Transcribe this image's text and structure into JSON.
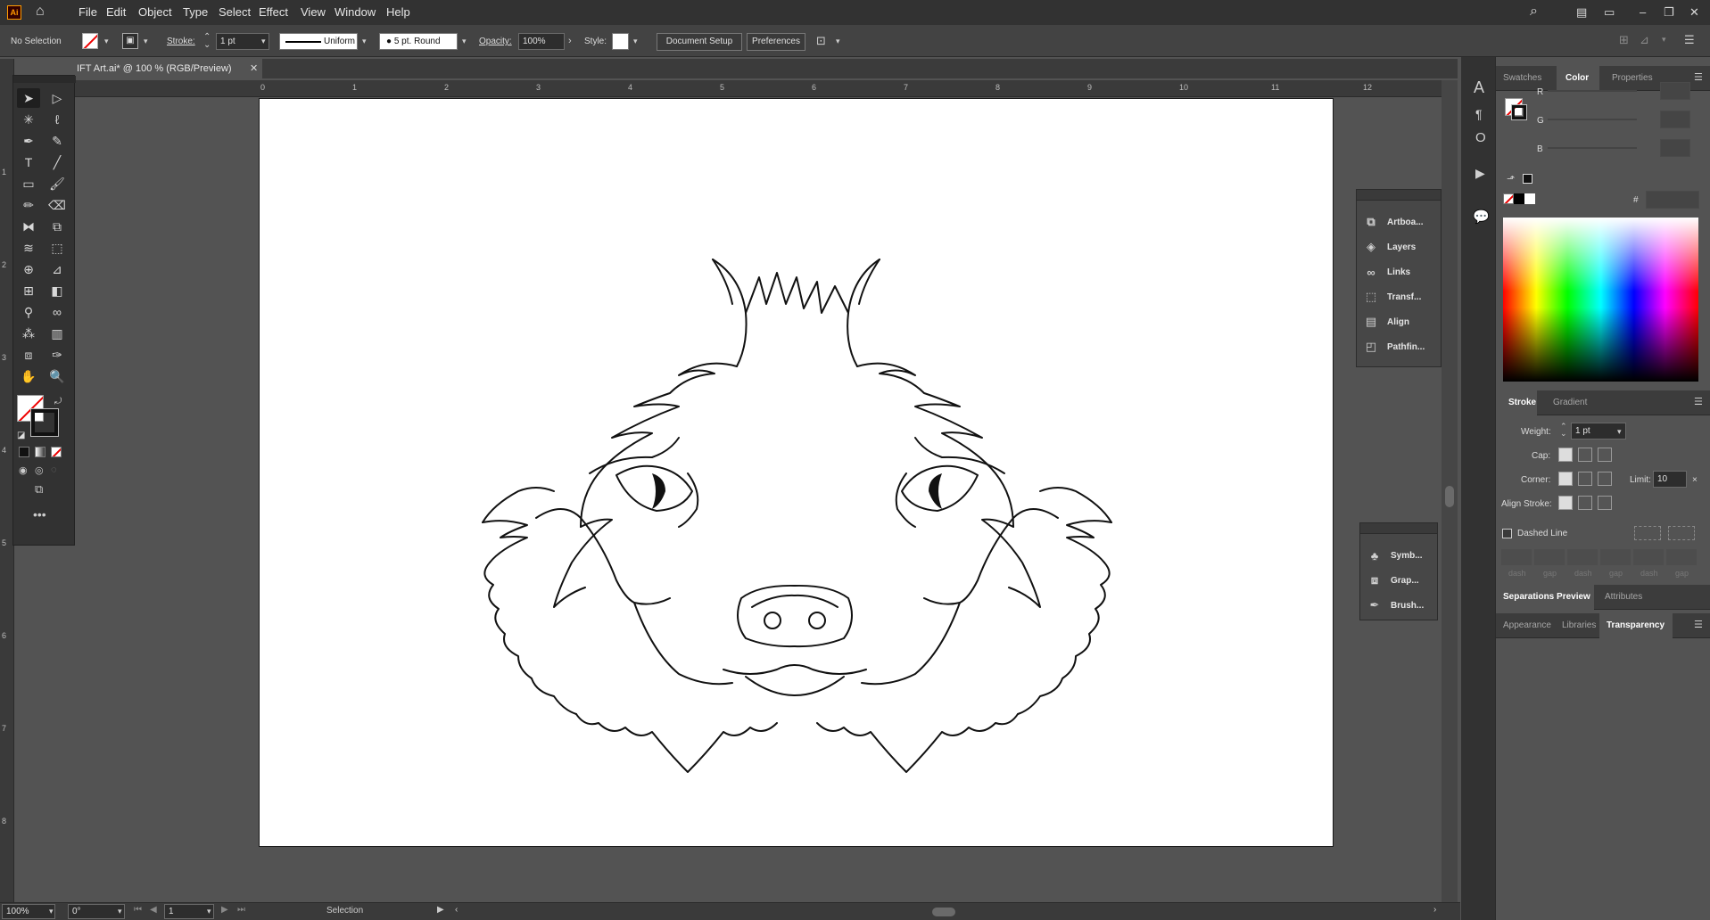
{
  "app": {
    "logo_text": "Ai"
  },
  "menu": [
    "File",
    "Edit",
    "Object",
    "Type",
    "Select",
    "Effect",
    "View",
    "Window",
    "Help"
  ],
  "control_bar": {
    "selection_label": "No Selection",
    "stroke_label": "Stroke:",
    "stroke_weight": "1 pt",
    "profile_label": "Uniform",
    "brush_label": "5 pt. Round",
    "opacity_label": "Opacity:",
    "opacity_value": "100%",
    "style_label": "Style:",
    "document_setup": "Document Setup",
    "preferences": "Preferences"
  },
  "document_tab": {
    "title": "IFT Art.ai* @ 100 % (RGB/Preview)"
  },
  "ruler": {
    "top_ticks": [
      "0",
      "1",
      "2",
      "3",
      "4",
      "5",
      "6",
      "7",
      "8",
      "9",
      "10",
      "11",
      "12"
    ],
    "left_ticks": [
      "1",
      "2",
      "3",
      "4",
      "5",
      "6",
      "7",
      "8"
    ]
  },
  "status_bar": {
    "zoom": "100%",
    "rotation": "0°",
    "artboard": "1",
    "tool": "Selection"
  },
  "floating_panel_1": [
    "Artboa...",
    "Layers",
    "Links",
    "Transf...",
    "Align",
    "Pathfin..."
  ],
  "floating_panel_2": [
    "Symb...",
    "Grap...",
    "Brush..."
  ],
  "color_panel": {
    "tabs": [
      "Swatches",
      "Color",
      "Properties"
    ],
    "active": "Color",
    "channels": [
      "R",
      "G",
      "B"
    ],
    "hex_prefix": "#"
  },
  "stroke_panel": {
    "tabs": [
      "Stroke",
      "Gradient"
    ],
    "active": "Stroke",
    "weight_label": "Weight:",
    "weight_value": "1 pt",
    "cap_label": "Cap:",
    "corner_label": "Corner:",
    "limit_label": "Limit:",
    "limit_value": "10",
    "align_label": "Align Stroke:",
    "dashed_label": "Dashed Line",
    "dash_gap": [
      "dash",
      "gap",
      "dash",
      "gap",
      "dash",
      "gap"
    ]
  },
  "sep_panel": {
    "tabs": [
      "Separations Preview",
      "Attributes"
    ]
  },
  "appearance_panel": {
    "tabs": [
      "Appearance",
      "Libraries",
      "Transparency"
    ],
    "active": "Transparency"
  }
}
